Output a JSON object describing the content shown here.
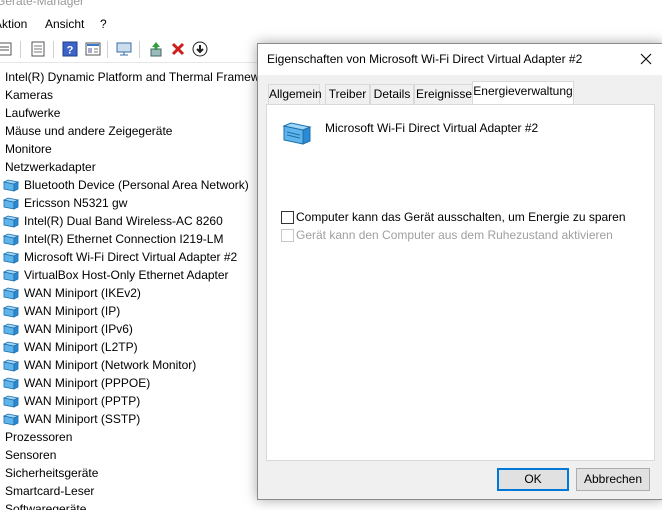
{
  "window": {
    "title": "Geräte-Manager"
  },
  "menu": {
    "action": "Aktion",
    "view": "Ansicht",
    "help": "?"
  },
  "toolbar": {
    "icons": [
      "properties-icon",
      "document-icon",
      "help-icon",
      "view-icon",
      "monitor-icon",
      "update-driver-icon",
      "uninstall-icon",
      "download-icon"
    ]
  },
  "tree": {
    "rows": [
      {
        "type": "category",
        "label": "Intel(R) Dynamic Platform and Thermal Framework"
      },
      {
        "type": "category",
        "label": "Kameras"
      },
      {
        "type": "category",
        "label": "Laufwerke"
      },
      {
        "type": "category",
        "label": "Mäuse und andere Zeigegeräte"
      },
      {
        "type": "category",
        "label": "Monitore"
      },
      {
        "type": "category",
        "label": "Netzwerkadapter"
      },
      {
        "type": "device",
        "label": "Bluetooth Device (Personal Area Network)"
      },
      {
        "type": "device",
        "label": "Ericsson N5321 gw"
      },
      {
        "type": "device",
        "label": "Intel(R) Dual Band Wireless-AC 8260"
      },
      {
        "type": "device",
        "label": "Intel(R) Ethernet Connection I219-LM"
      },
      {
        "type": "device",
        "label": "Microsoft Wi-Fi Direct Virtual Adapter #2"
      },
      {
        "type": "device",
        "label": "VirtualBox Host-Only Ethernet Adapter"
      },
      {
        "type": "device",
        "label": "WAN Miniport (IKEv2)"
      },
      {
        "type": "device",
        "label": "WAN Miniport (IP)"
      },
      {
        "type": "device",
        "label": "WAN Miniport (IPv6)"
      },
      {
        "type": "device",
        "label": "WAN Miniport (L2TP)"
      },
      {
        "type": "device",
        "label": "WAN Miniport (Network Monitor)"
      },
      {
        "type": "device",
        "label": "WAN Miniport (PPPOE)"
      },
      {
        "type": "device",
        "label": "WAN Miniport (PPTP)"
      },
      {
        "type": "device",
        "label": "WAN Miniport (SSTP)"
      },
      {
        "type": "category",
        "label": "Prozessoren"
      },
      {
        "type": "category",
        "label": "Sensoren"
      },
      {
        "type": "category",
        "label": "Sicherheitsgeräte"
      },
      {
        "type": "category",
        "label": "Smartcard-Leser"
      },
      {
        "type": "category",
        "label": "Softwaregeräte"
      }
    ]
  },
  "dialog": {
    "title": "Eigenschaften von Microsoft Wi-Fi Direct Virtual Adapter #2",
    "tabs": [
      "Allgemein",
      "Treiber",
      "Details",
      "Ereignisse",
      "Energieverwaltung"
    ],
    "active_tab": "Energieverwaltung",
    "device_name": "Microsoft Wi-Fi Direct Virtual Adapter #2",
    "options": [
      {
        "label": "Computer kann das Gerät ausschalten, um Energie zu sparen",
        "checked": false,
        "enabled": true
      },
      {
        "label": "Gerät kann den Computer aus dem Ruhezustand aktivieren",
        "checked": false,
        "enabled": false
      }
    ],
    "ok_label": "OK",
    "cancel_label": "Abbrechen"
  },
  "colors": {
    "accent": "#0078d7",
    "icon_blue": "#2a8ad4",
    "disabled_text": "#a0a0a0"
  }
}
